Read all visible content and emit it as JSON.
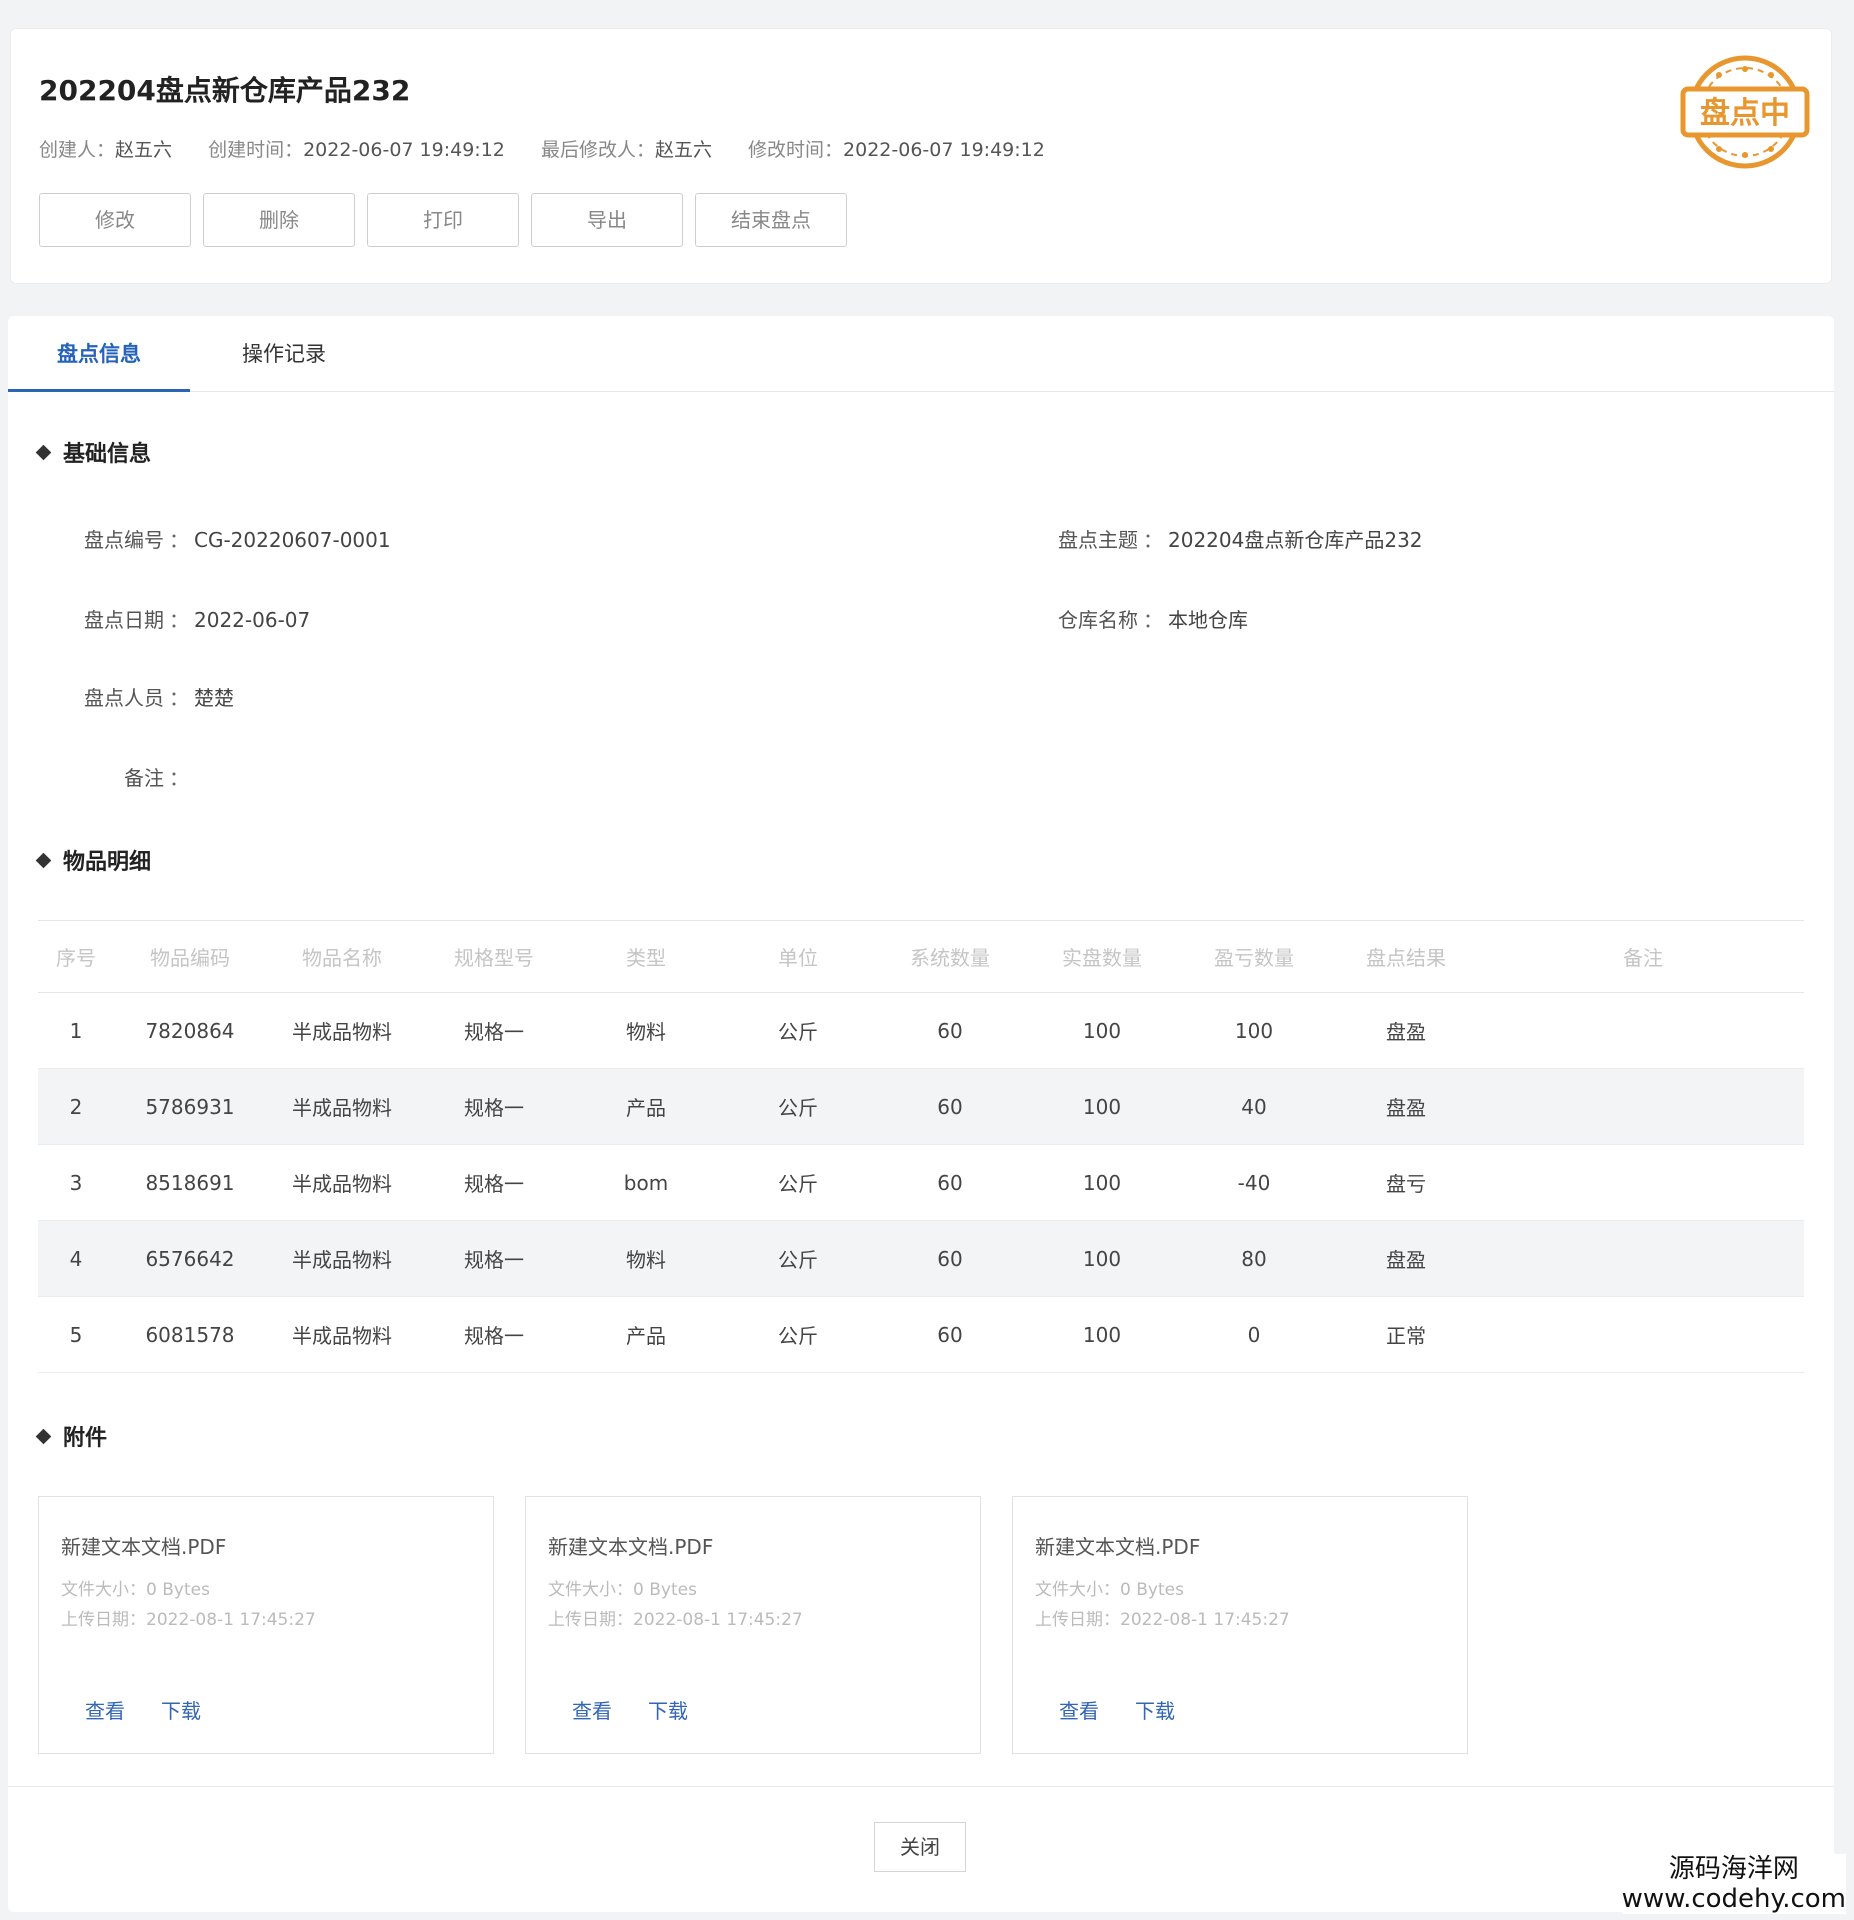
{
  "header": {
    "title": "202204盘点新仓库产品232",
    "meta": [
      {
        "label": "创建人：",
        "value": "赵五六"
      },
      {
        "label": "创建时间：",
        "value": "2022-06-07 19:49:12"
      },
      {
        "label": "最后修改人：",
        "value": "赵五六"
      },
      {
        "label": "修改时间：",
        "value": "2022-06-07 19:49:12"
      }
    ],
    "buttons": [
      "修改",
      "删除",
      "打印",
      "导出",
      "结束盘点"
    ],
    "stamp_text": "盘点中",
    "stamp_color": "#e8962e"
  },
  "tabs": [
    {
      "label": "盘点信息",
      "active": true
    },
    {
      "label": "操作记录",
      "active": false
    }
  ],
  "basic": {
    "title": "基础信息",
    "fields": {
      "code": {
        "label": "盘点编号",
        "value": "CG-20220607-0001"
      },
      "subject": {
        "label": "盘点主题",
        "value": "202204盘点新仓库产品232"
      },
      "date": {
        "label": "盘点日期",
        "value": "2022-06-07"
      },
      "warehouse": {
        "label": "仓库名称",
        "value": "本地仓库"
      },
      "staff": {
        "label": "盘点人员",
        "value": "楚楚"
      },
      "remark": {
        "label": "备注",
        "value": ""
      }
    },
    "colon": "："
  },
  "items": {
    "title": "物品明细",
    "columns": [
      "序号",
      "物品编码",
      "物品名称",
      "规格型号",
      "类型",
      "单位",
      "系统数量",
      "实盘数量",
      "盈亏数量",
      "盘点结果",
      "备注"
    ],
    "rows": [
      [
        "1",
        "7820864",
        "半成品物料",
        "规格一",
        "物料",
        "公斤",
        "60",
        "100",
        "100",
        "盘盈",
        ""
      ],
      [
        "2",
        "5786931",
        "半成品物料",
        "规格一",
        "产品",
        "公斤",
        "60",
        "100",
        "40",
        "盘盈",
        ""
      ],
      [
        "3",
        "8518691",
        "半成品物料",
        "规格一",
        "bom",
        "公斤",
        "60",
        "100",
        "-40",
        "盘亏",
        ""
      ],
      [
        "4",
        "6576642",
        "半成品物料",
        "规格一",
        "物料",
        "公斤",
        "60",
        "100",
        "80",
        "盘盈",
        ""
      ],
      [
        "5",
        "6081578",
        "半成品物料",
        "规格一",
        "产品",
        "公斤",
        "60",
        "100",
        "0",
        "正常",
        ""
      ]
    ]
  },
  "attachments": {
    "title": "附件",
    "files": [
      {
        "name": "新建文本文档.PDF",
        "size": "文件大小：0 Bytes",
        "date": "上传日期：2022-08-1 17:45:27",
        "view": "查看",
        "download": "下载"
      },
      {
        "name": "新建文本文档.PDF",
        "size": "文件大小：0 Bytes",
        "date": "上传日期：2022-08-1 17:45:27",
        "view": "查看",
        "download": "下载"
      },
      {
        "name": "新建文本文档.PDF",
        "size": "文件大小：0 Bytes",
        "date": "上传日期：2022-08-1 17:45:27",
        "view": "查看",
        "download": "下载"
      }
    ]
  },
  "footer": {
    "close_label": "关闭"
  },
  "watermark": {
    "line1": "源码海洋网",
    "line2": "www.codehy.com"
  }
}
